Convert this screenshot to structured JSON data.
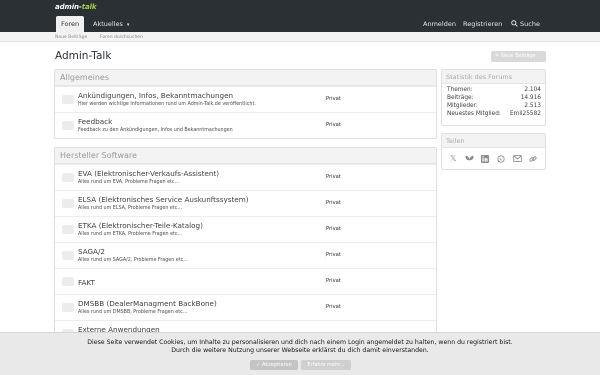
{
  "header": {
    "logo_left": "admin-",
    "logo_right": "talk",
    "nav_tabs": [
      {
        "label": "Foren"
      },
      {
        "label": "Aktuelles"
      }
    ],
    "right": {
      "login": "Anmelden",
      "register": "Registrieren",
      "search": "Suche"
    }
  },
  "subnav": {
    "items": [
      "Neue Beiträge",
      "Foren durchsuchen"
    ]
  },
  "page": {
    "title": "Admin-Talk",
    "new_posts_button": "Neue Beiträge"
  },
  "categories": [
    {
      "title": "Allgemeines",
      "forums": [
        {
          "title": "Ankündigungen, Infos, Bekanntmachungen",
          "desc": "Hier werden wichtige Informationen rund um Admin-Talk.de veröffentlicht.",
          "status": "Privat"
        },
        {
          "title": "Feedback",
          "desc": "Feedback zu den Ankündigungen, Infos und Bekanntmachungen",
          "status": "Privat"
        }
      ]
    },
    {
      "title": "Hersteller Software",
      "forums": [
        {
          "title": "EVA (Elektronischer-Verkaufs-Assistent)",
          "desc": "Alles rund um EVA, Probleme Fragen etc...",
          "status": "Privat"
        },
        {
          "title": "ELSA (Elektronisches Service Auskunftssystem)",
          "desc": "Alles rund um ELSA, Probleme Fragen etc...",
          "status": "Privat"
        },
        {
          "title": "ETKA (Elektronischer-Teile-Katalog)",
          "desc": "Alles rund um ETKA, Probleme Fragen etc...",
          "status": "Privat"
        },
        {
          "title": "SAGA/2",
          "desc": "Alles rund um SAGA/2, Probleme Fragen etc...",
          "status": "Privat"
        },
        {
          "title": "FAKT",
          "desc": "",
          "status": "Privat"
        },
        {
          "title": "DMSBB (DealerManagment BackBone)",
          "desc": "Alles rund um DMSBB, Probleme Fragen etc...",
          "status": "Privat"
        },
        {
          "title": "Externe Anwendungen",
          "desc": "",
          "status": ""
        }
      ]
    }
  ],
  "stats": {
    "title": "Statistik des Forums",
    "rows": [
      {
        "k": "Themen:",
        "v": "2.104"
      },
      {
        "k": "Beiträge:",
        "v": "14.916"
      },
      {
        "k": "Mitglieder:",
        "v": "2.513"
      },
      {
        "k": "Neuestes Mitglied:",
        "v": "Emil25582"
      }
    ]
  },
  "share": {
    "title": "Teilen",
    "icons": [
      "x-icon",
      "bluesky-icon",
      "linkedin-icon",
      "whatsapp-icon",
      "email-icon",
      "link-icon"
    ]
  },
  "cookie": {
    "line1": "Diese Seite verwendet Cookies, um Inhalte zu personalisieren und dich nach einem Login angemeldet zu halten, wenn du registriert bist.",
    "line2": "Durch die weitere Nutzung unserer Webseite erklärst du dich damit einverstanden.",
    "accept": "Akzeptieren",
    "more": "Erfahre mehr..."
  },
  "colors": {
    "header_bg": "#2b3035",
    "logo_accent": "#a4cf47",
    "button_bg": "#d9d9d9"
  }
}
